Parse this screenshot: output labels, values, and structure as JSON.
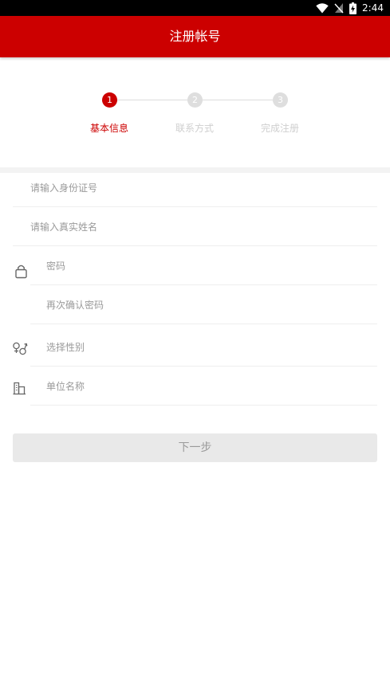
{
  "status_bar": {
    "time": "2:44",
    "icons": [
      "wifi-icon",
      "no-signal-icon",
      "battery-charging-icon"
    ]
  },
  "header": {
    "title": "注册帐号",
    "background_color": "#cc0000"
  },
  "steps": [
    {
      "number": "1",
      "label": "基本信息",
      "state": "active"
    },
    {
      "number": "2",
      "label": "联系方式",
      "state": "inactive"
    },
    {
      "number": "3",
      "label": "完成注册",
      "state": "inactive"
    }
  ],
  "colors": {
    "accent": "#cc0000",
    "inactive_step": "#dedede",
    "placeholder": "#9a9a9a"
  },
  "form": {
    "id_number": {
      "placeholder": "请输入身份证号",
      "value": ""
    },
    "real_name": {
      "placeholder": "请输入真实姓名",
      "value": ""
    },
    "password": {
      "placeholder": "密码",
      "value": "",
      "icon": "lock-icon"
    },
    "confirm_password": {
      "placeholder": "再次确认密码",
      "value": ""
    },
    "gender": {
      "placeholder": "选择性别",
      "value": "",
      "icon": "gender-icon"
    },
    "organization": {
      "placeholder": "单位名称",
      "value": "",
      "icon": "building-icon"
    }
  },
  "actions": {
    "next_label": "下一步"
  }
}
